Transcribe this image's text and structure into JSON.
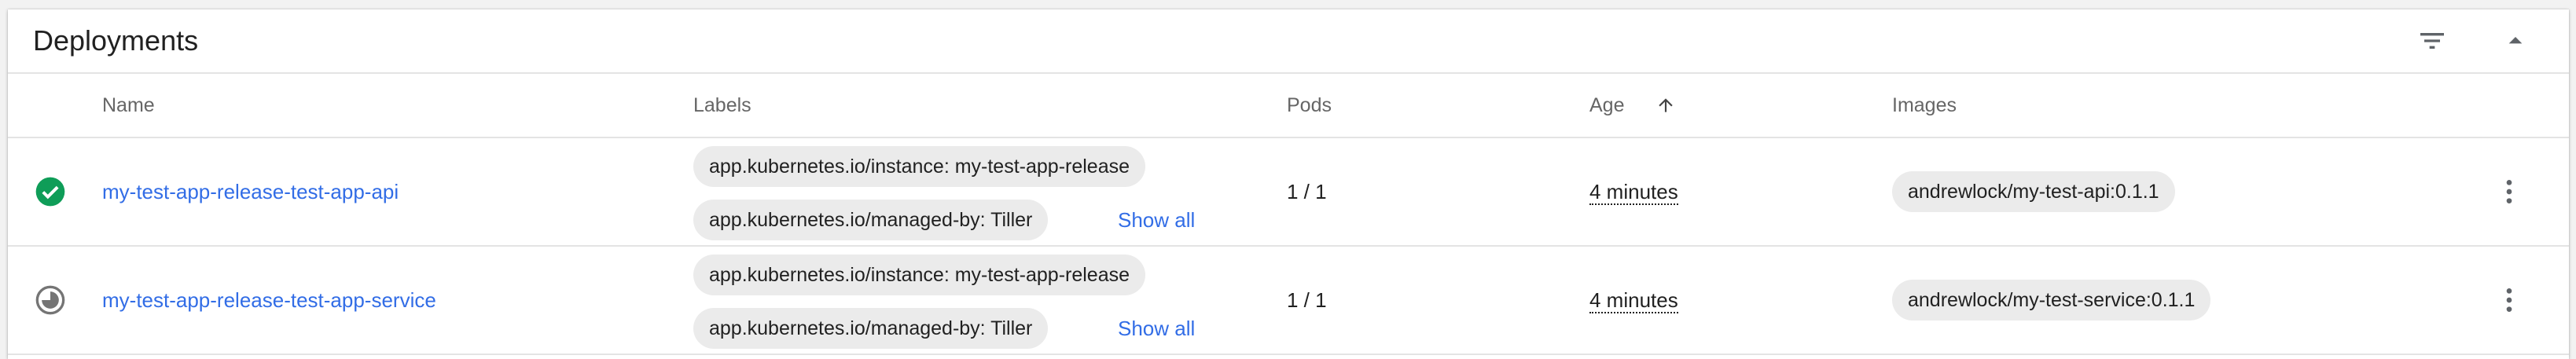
{
  "card": {
    "title": "Deployments",
    "icons": [
      "filter-icon",
      "collapse-icon"
    ]
  },
  "columns": {
    "name": "Name",
    "labels": "Labels",
    "pods": "Pods",
    "age": "Age",
    "images": "Images",
    "age_sort_icon": "arrow-up-icon"
  },
  "rows": [
    {
      "status_icon": "check-circle-icon",
      "status_color": "#0f9d58",
      "name": "my-test-app-release-test-app-api",
      "labels": [
        "app.kubernetes.io/instance: my-test-app-release",
        "app.kubernetes.io/managed-by: Tiller"
      ],
      "show_all": "Show all",
      "pods": "1 / 1",
      "age": "4 minutes",
      "image": "andrewlock/my-test-api:0.1.1",
      "menu_icon": "more-vert-icon"
    },
    {
      "status_icon": "pending-circle-icon",
      "status_color": "#757575",
      "name": "my-test-app-release-test-app-service",
      "labels": [
        "app.kubernetes.io/instance: my-test-app-release",
        "app.kubernetes.io/managed-by: Tiller"
      ],
      "show_all": "Show all",
      "pods": "1 / 1",
      "age": "4 minutes",
      "image": "andrewlock/my-test-service:0.1.1",
      "menu_icon": "more-vert-icon"
    }
  ]
}
